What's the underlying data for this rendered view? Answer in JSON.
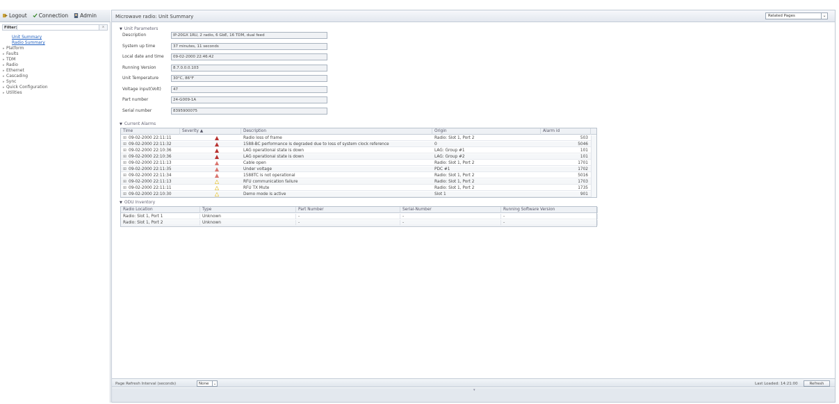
{
  "topbar": {
    "logout": "Logout",
    "connection": "Connection",
    "admin": "Admin"
  },
  "filter": {
    "label": "Filter:"
  },
  "nav": [
    {
      "label": "Unit Summary",
      "sub": true
    },
    {
      "label": "Radio Summary",
      "sub": true
    },
    {
      "label": "Platform",
      "sub": false
    },
    {
      "label": "Faults",
      "sub": false
    },
    {
      "label": "TDM",
      "sub": false
    },
    {
      "label": "Radio",
      "sub": false
    },
    {
      "label": "Ethernet",
      "sub": false
    },
    {
      "label": "Cascading",
      "sub": false
    },
    {
      "label": "Sync",
      "sub": false
    },
    {
      "label": "Quick Configuration",
      "sub": false
    },
    {
      "label": "Utilities",
      "sub": false
    }
  ],
  "main": {
    "title": "Microwave radio: Unit Summary",
    "related_pages": "Related Pages"
  },
  "unit_parameters": {
    "header": "Unit Parameters",
    "rows": [
      {
        "label": "Description",
        "value": "IP-20GX 1RU, 2 radio, 6 GbE, 16 TDM, dual feed"
      },
      {
        "label": "System up time",
        "value": "37 minutes, 11 seconds"
      },
      {
        "label": "Local date and time",
        "value": "09-02-2000 22:46:42"
      },
      {
        "label": "Running Version",
        "value": "8.7.0.0.0.103"
      },
      {
        "label": "Unit Temperature",
        "value": "30°C, 86°F"
      },
      {
        "label": "Voltage input(Volt)",
        "value": "47"
      },
      {
        "label": "Part number",
        "value": "24-G009-1A"
      },
      {
        "label": "Serial number",
        "value": "8395900075"
      }
    ]
  },
  "current_alarms": {
    "header": "Current Alarms",
    "columns": [
      "Time",
      "Severity ▲",
      "Description",
      "Origin",
      "Alarm id"
    ],
    "rows": [
      {
        "time": "09-02-2000 22:11:11",
        "severity": "critical",
        "description": "Radio loss of frame",
        "origin": "Radio: Slot 1, Port 2",
        "id": "503"
      },
      {
        "time": "09-02-2000 22:11:32",
        "severity": "critical",
        "description": "1588-BC performance is degraded due to loss of system clock reference",
        "origin": "0",
        "id": "5046"
      },
      {
        "time": "09-02-2000 22:10:36",
        "severity": "critical",
        "description": "LAG operational state is down",
        "origin": "LAG: Group #1",
        "id": "101"
      },
      {
        "time": "09-02-2000 22:10:36",
        "severity": "critical",
        "description": "LAG operational state is down",
        "origin": "LAG: Group #2",
        "id": "101"
      },
      {
        "time": "09-02-2000 22:11:13",
        "severity": "major",
        "description": "Cable open",
        "origin": "Radio: Slot 1, Port 2",
        "id": "1701"
      },
      {
        "time": "09-02-2000 22:11:35",
        "severity": "major",
        "description": "Under voltage",
        "origin": "PDC #1",
        "id": "1702"
      },
      {
        "time": "09-02-2000 22:11:34",
        "severity": "major",
        "description": "1588TC is not operational",
        "origin": "Radio: Slot 1, Port 2",
        "id": "5016"
      },
      {
        "time": "09-02-2000 22:11:13",
        "severity": "warning",
        "description": "RFU communication failure",
        "origin": "Radio: Slot 1, Port 2",
        "id": "1703"
      },
      {
        "time": "09-02-2000 22:11:11",
        "severity": "warning",
        "description": "RFU TX Mute",
        "origin": "Radio: Slot 1, Port 2",
        "id": "1735"
      },
      {
        "time": "09-02-2000 22:10:30",
        "severity": "warning",
        "description": "Demo mode is active",
        "origin": "Slot 1",
        "id": "901"
      }
    ]
  },
  "odu_inventory": {
    "header": "ODU Inventory",
    "columns": [
      "Radio Location",
      "Type",
      "Part Number",
      "Serial-Number",
      "Running Software Version"
    ],
    "rows": [
      {
        "location": "Radio: Slot 1, Port 1",
        "type": "Unknown",
        "part": "-",
        "serial": "-",
        "version": "-"
      },
      {
        "location": "Radio: Slot 1, Port 2",
        "type": "Unknown",
        "part": "-",
        "serial": "-",
        "version": "-"
      }
    ]
  },
  "footer": {
    "refresh_label": "Page Refresh Interval (seconds)",
    "refresh_value": "None",
    "last_loaded": "Last Loaded: 14:21:00",
    "refresh_button": "Refresh"
  },
  "colors": {
    "critical": "#b8312f",
    "major": "#d2524a",
    "warning": "#e6c84a"
  }
}
